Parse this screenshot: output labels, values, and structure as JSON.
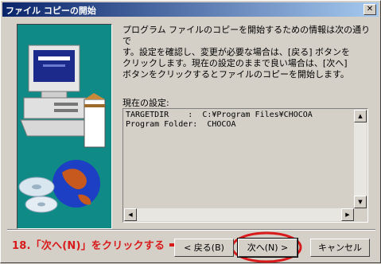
{
  "window": {
    "title": "ファイル コピーの開始",
    "close_glyph": "✕"
  },
  "message": "プログラム ファイルのコピーを開始するための情報は次の通りで\nす。設定を確認し、変更が必要な場合は、[戻る] ボタンを\nクリックします。現在の設定のままで良い場合は、[次へ]\nボタンをクリックするとファイルのコピーを開始します。",
  "settings": {
    "label": "現在の設定:",
    "text": "TARGETDIR    :  C:¥Program Files¥CHOCOA\nProgram Folder:  CHOCOA"
  },
  "scroll": {
    "up": "▲",
    "down": "▼",
    "left": "◀",
    "right": "▶"
  },
  "buttons": {
    "back": "< 戻る(B)",
    "next": "次へ(N) >",
    "cancel": "キャンセル"
  },
  "annotation": {
    "text": "18.「次へ(N)」をクリックする",
    "color": "#d81a1a"
  }
}
